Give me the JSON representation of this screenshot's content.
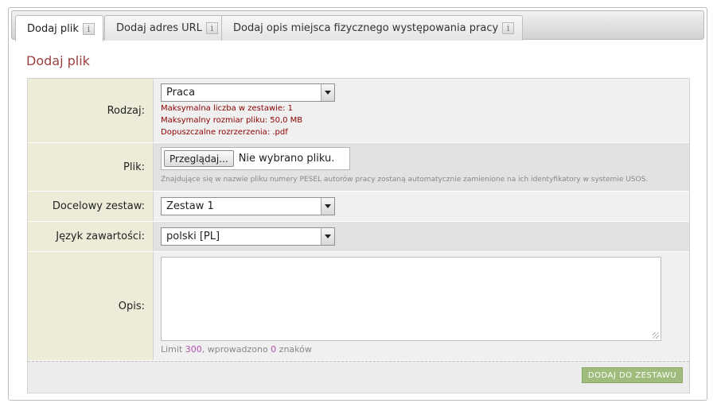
{
  "tabs": [
    {
      "label": "Dodaj plik",
      "active": true
    },
    {
      "label": "Dodaj adres URL",
      "active": false
    },
    {
      "label": "Dodaj opis miejsca fizycznego występowania pracy",
      "active": false
    }
  ],
  "info_icon_glyph": "i",
  "page_title": "Dodaj plik",
  "form": {
    "rodzaj": {
      "label": "Rodzaj:",
      "value": "Praca",
      "hints": [
        "Maksymalna liczba w zestawie: 1",
        "Maksymalny rozmiar pliku: 50,0 MB",
        "Dopuszczalne rozrzerzenia: .pdf"
      ]
    },
    "plik": {
      "label": "Plik:",
      "browse_label": "Przeglądaj...",
      "no_file_text": "Nie wybrano pliku.",
      "note": "Znajdujące się w nazwie pliku numery PESEL autorów pracy zostaną automatycznie zamienione na ich identyfikatory w systemie USOS."
    },
    "zestaw": {
      "label": "Docelowy zestaw:",
      "value": "Zestaw 1"
    },
    "jezyk": {
      "label": "Język zawartości:",
      "value": "polski [PL]"
    },
    "opis": {
      "label": "Opis:",
      "value": "",
      "limit_prefix": "Limit ",
      "limit_value": "300",
      "limit_middle": ", wprowadzono ",
      "entered_value": "0",
      "limit_suffix": " znaków"
    }
  },
  "submit_label": "DODAJ DO ZESTAWU",
  "colors": {
    "title": "#9a3f3f",
    "hint_red": "#8b0000",
    "submit_bg": "#9fbc7c",
    "label_bg": "#ececd9",
    "limit_number": "#b04fb0"
  }
}
